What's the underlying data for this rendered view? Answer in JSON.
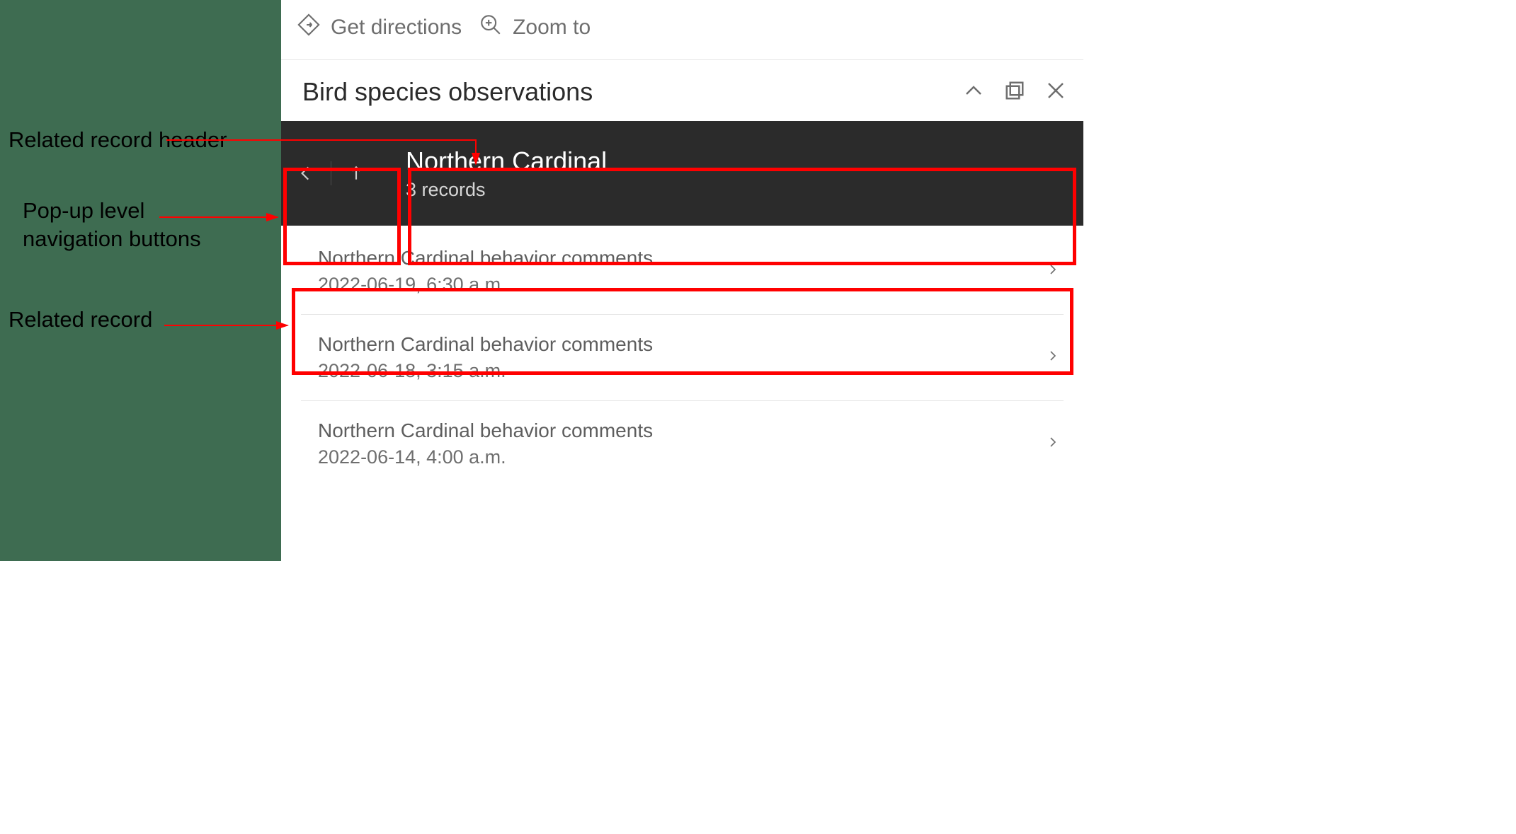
{
  "actions": {
    "directions": "Get directions",
    "zoom": "Zoom to"
  },
  "popup": {
    "title": "Bird species observations"
  },
  "header": {
    "title": "Northern Cardinal",
    "subtitle": "3 records"
  },
  "records": [
    {
      "title": "Northern Cardinal behavior comments",
      "date": "2022-06-19, 6:30 a.m."
    },
    {
      "title": "Northern Cardinal behavior comments",
      "date": "2022-06-18, 3:15 a.m."
    },
    {
      "title": "Northern Cardinal behavior comments",
      "date": "2022-06-14, 4:00 a.m."
    }
  ],
  "annotations": {
    "header": "Related record header",
    "nav": "Pop-up level navigation buttons",
    "record": "Related record"
  }
}
